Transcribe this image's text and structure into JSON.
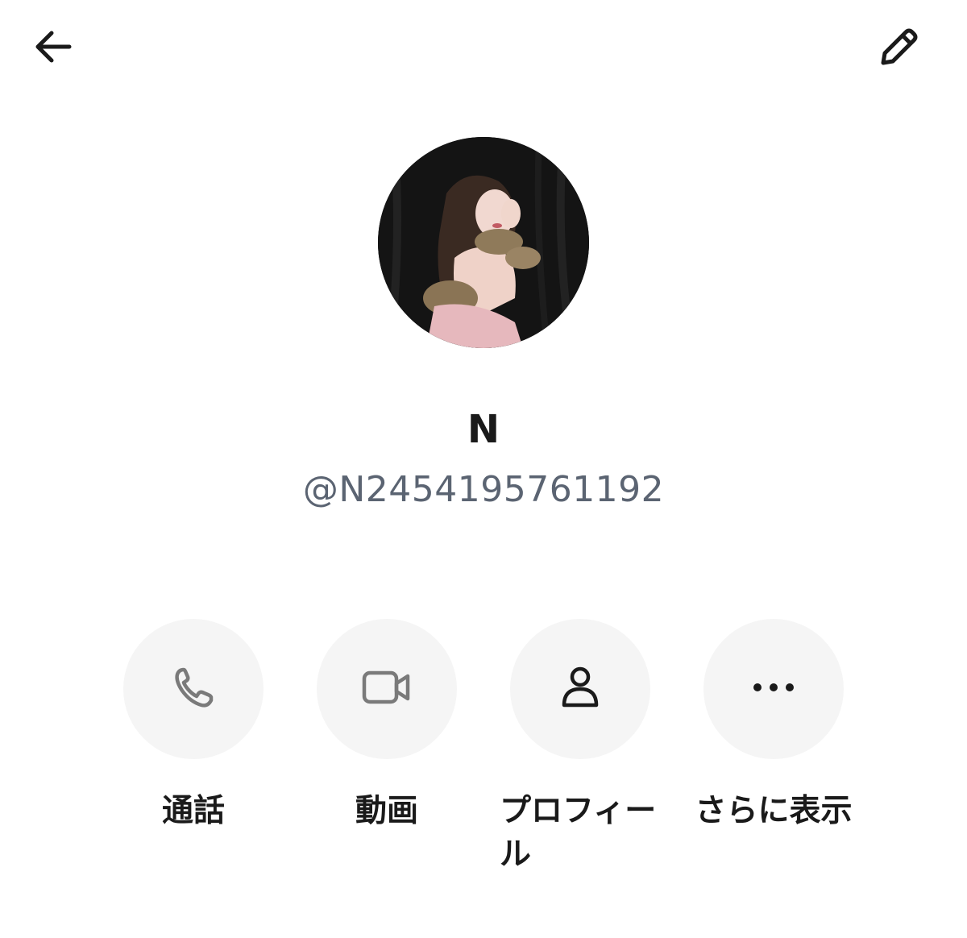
{
  "header": {
    "back_icon": "arrow-left-icon",
    "edit_icon": "pencil-icon"
  },
  "profile": {
    "display_name": "N",
    "user_id": "@N2454195761192"
  },
  "actions": [
    {
      "label": "通話",
      "icon": "phone-icon"
    },
    {
      "label": "動画",
      "icon": "video-camera-icon"
    },
    {
      "label": "プロフィール",
      "icon": "person-icon"
    },
    {
      "label": "さらに表示",
      "icon": "more-dots-icon"
    }
  ],
  "colors": {
    "background": "#ffffff",
    "action_circle": "#f5f5f5",
    "user_id_text": "#5b6472",
    "icon_gray": "#7a7a7a"
  }
}
